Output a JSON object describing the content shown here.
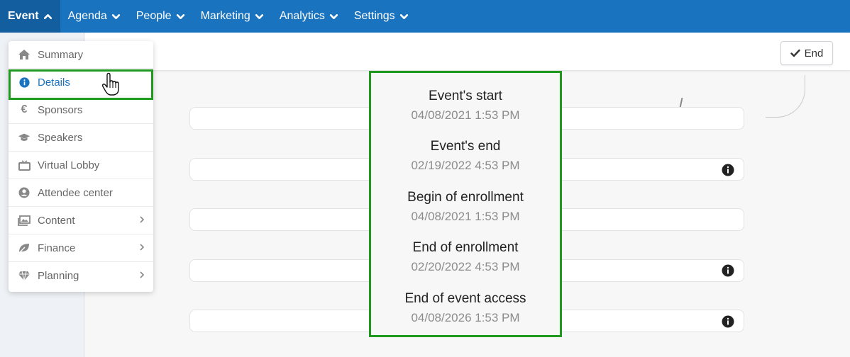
{
  "nav": {
    "items": [
      {
        "label": "Event",
        "active": true
      },
      {
        "label": "Agenda"
      },
      {
        "label": "People"
      },
      {
        "label": "Marketing"
      },
      {
        "label": "Analytics"
      },
      {
        "label": "Settings"
      }
    ]
  },
  "toolbar": {
    "end_label": "End"
  },
  "menu": {
    "items": [
      {
        "label": "Summary",
        "icon": "home-icon"
      },
      {
        "label": "Details",
        "icon": "info-circle-icon",
        "selected": true
      },
      {
        "label": "Sponsors",
        "icon": "euro-icon"
      },
      {
        "label": "Speakers",
        "icon": "graduation-cap-icon"
      },
      {
        "label": "Virtual Lobby",
        "icon": "tv-icon"
      },
      {
        "label": "Attendee center",
        "icon": "user-circle-icon"
      },
      {
        "label": "Content",
        "icon": "images-icon",
        "submenu": true
      },
      {
        "label": "Finance",
        "icon": "leaf-icon",
        "submenu": true
      },
      {
        "label": "Planning",
        "icon": "diamond-icon",
        "submenu": true
      }
    ]
  },
  "dates": [
    {
      "label": "Event's start",
      "value": "04/08/2021 1:53 PM"
    },
    {
      "label": "Event's end",
      "value": "02/19/2022 4:53 PM"
    },
    {
      "label": "Begin of enrollment",
      "value": "04/08/2021 1:53 PM"
    },
    {
      "label": "End of enrollment",
      "value": "02/20/2022 4:53 PM"
    },
    {
      "label": "End of event access",
      "value": "04/08/2026 1:53 PM"
    }
  ],
  "colors": {
    "nav_bg": "#1a73bf",
    "nav_active_bg": "#135e9f",
    "highlight_green": "#1f9a1f",
    "selected_text": "#1a73bf"
  }
}
